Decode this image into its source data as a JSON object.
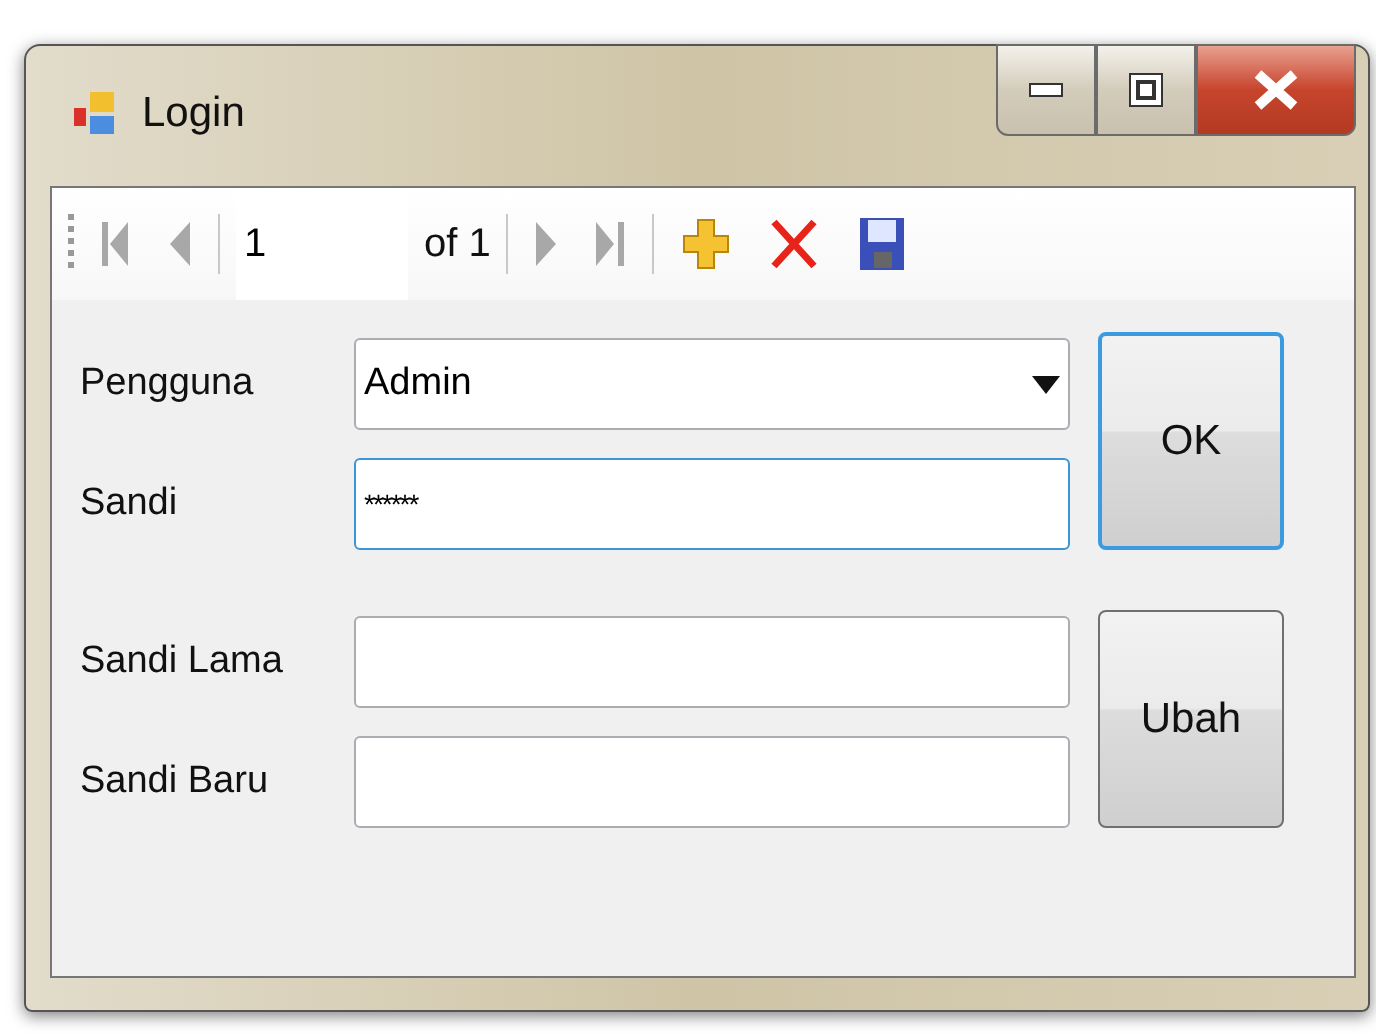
{
  "window": {
    "title": "Login"
  },
  "title_buttons": [
    {
      "kind": "minimize"
    },
    {
      "kind": "maximize"
    },
    {
      "kind": "close"
    }
  ],
  "toolbar": {
    "items": [
      {
        "kind": "first",
        "disabled": true
      },
      {
        "kind": "prev",
        "disabled": true
      },
      {
        "kind": "separator"
      },
      {
        "kind": "position",
        "value": "1"
      },
      {
        "kind": "count",
        "text": "of 1"
      },
      {
        "kind": "separator"
      },
      {
        "kind": "next",
        "disabled": true
      },
      {
        "kind": "last",
        "disabled": true
      },
      {
        "kind": "separator"
      },
      {
        "kind": "add",
        "disabled": false
      },
      {
        "kind": "delete",
        "disabled": false
      },
      {
        "kind": "save",
        "disabled": false
      }
    ]
  },
  "sections": [
    {
      "fields": [
        {
          "label": "Pengguna",
          "kind": "dropdown",
          "value": "Admin",
          "focused": false
        },
        {
          "label": "Sandi",
          "kind": "password",
          "value": "******",
          "focused": true
        }
      ],
      "button": {
        "label": "OK",
        "default": true
      }
    },
    {
      "fields": [
        {
          "label": "Sandi Lama",
          "kind": "password",
          "focused": false
        },
        {
          "label": "Sandi Baru",
          "kind": "password",
          "focused": false
        }
      ],
      "button": {
        "label": "Ubah",
        "default": false
      }
    }
  ]
}
